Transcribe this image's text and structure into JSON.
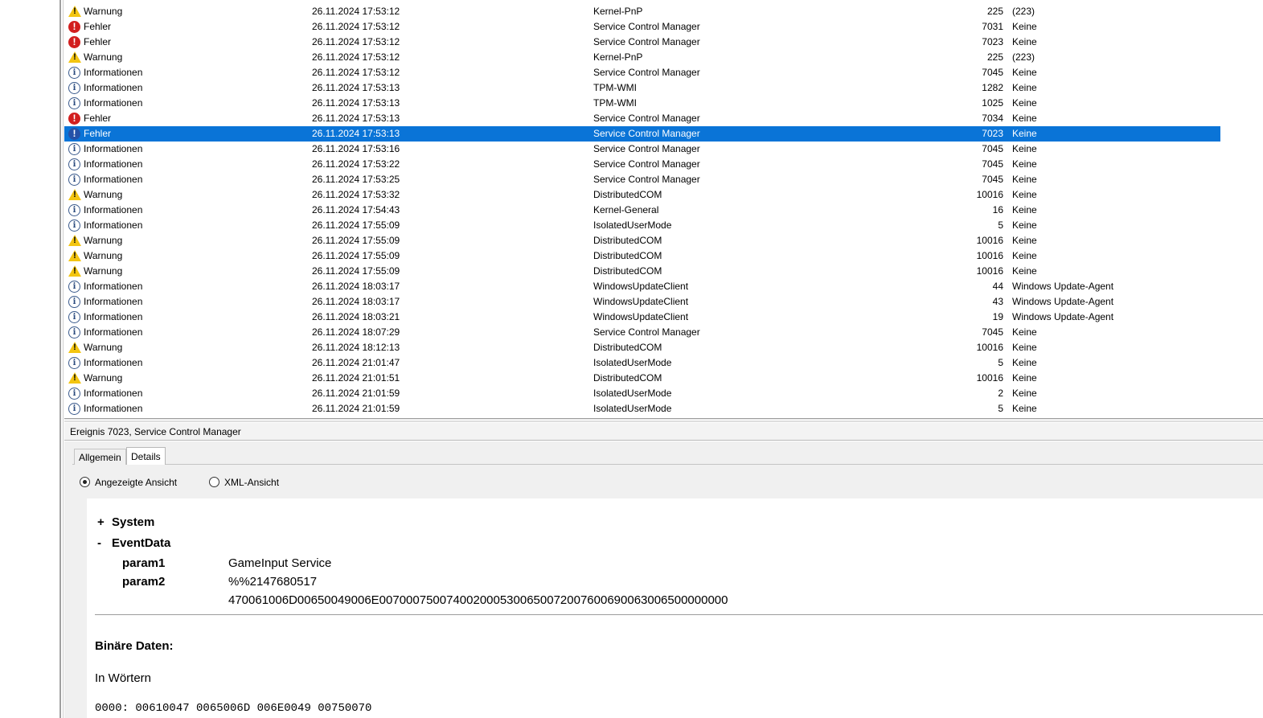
{
  "events": [
    {
      "level": "Warnung",
      "type": "warning",
      "date": "26.11.2024 17:53:12",
      "source": "Kernel-PnP",
      "id": "225",
      "task": "(223)"
    },
    {
      "level": "Fehler",
      "type": "error",
      "date": "26.11.2024 17:53:12",
      "source": "Service Control Manager",
      "id": "7031",
      "task": "Keine"
    },
    {
      "level": "Fehler",
      "type": "error",
      "date": "26.11.2024 17:53:12",
      "source": "Service Control Manager",
      "id": "7023",
      "task": "Keine"
    },
    {
      "level": "Warnung",
      "type": "warning",
      "date": "26.11.2024 17:53:12",
      "source": "Kernel-PnP",
      "id": "225",
      "task": "(223)"
    },
    {
      "level": "Informationen",
      "type": "info",
      "date": "26.11.2024 17:53:12",
      "source": "Service Control Manager",
      "id": "7045",
      "task": "Keine"
    },
    {
      "level": "Informationen",
      "type": "info",
      "date": "26.11.2024 17:53:13",
      "source": "TPM-WMI",
      "id": "1282",
      "task": "Keine"
    },
    {
      "level": "Informationen",
      "type": "info",
      "date": "26.11.2024 17:53:13",
      "source": "TPM-WMI",
      "id": "1025",
      "task": "Keine"
    },
    {
      "level": "Fehler",
      "type": "error",
      "date": "26.11.2024 17:53:13",
      "source": "Service Control Manager",
      "id": "7034",
      "task": "Keine"
    },
    {
      "level": "Fehler",
      "type": "error",
      "date": "26.11.2024 17:53:13",
      "source": "Service Control Manager",
      "id": "7023",
      "task": "Keine",
      "selected": true
    },
    {
      "level": "Informationen",
      "type": "info",
      "date": "26.11.2024 17:53:16",
      "source": "Service Control Manager",
      "id": "7045",
      "task": "Keine"
    },
    {
      "level": "Informationen",
      "type": "info",
      "date": "26.11.2024 17:53:22",
      "source": "Service Control Manager",
      "id": "7045",
      "task": "Keine"
    },
    {
      "level": "Informationen",
      "type": "info",
      "date": "26.11.2024 17:53:25",
      "source": "Service Control Manager",
      "id": "7045",
      "task": "Keine"
    },
    {
      "level": "Warnung",
      "type": "warning",
      "date": "26.11.2024 17:53:32",
      "source": "DistributedCOM",
      "id": "10016",
      "task": "Keine"
    },
    {
      "level": "Informationen",
      "type": "info",
      "date": "26.11.2024 17:54:43",
      "source": "Kernel-General",
      "id": "16",
      "task": "Keine"
    },
    {
      "level": "Informationen",
      "type": "info",
      "date": "26.11.2024 17:55:09",
      "source": "IsolatedUserMode",
      "id": "5",
      "task": "Keine"
    },
    {
      "level": "Warnung",
      "type": "warning",
      "date": "26.11.2024 17:55:09",
      "source": "DistributedCOM",
      "id": "10016",
      "task": "Keine"
    },
    {
      "level": "Warnung",
      "type": "warning",
      "date": "26.11.2024 17:55:09",
      "source": "DistributedCOM",
      "id": "10016",
      "task": "Keine"
    },
    {
      "level": "Warnung",
      "type": "warning",
      "date": "26.11.2024 17:55:09",
      "source": "DistributedCOM",
      "id": "10016",
      "task": "Keine"
    },
    {
      "level": "Informationen",
      "type": "info",
      "date": "26.11.2024 18:03:17",
      "source": "WindowsUpdateClient",
      "id": "44",
      "task": "Windows Update-Agent"
    },
    {
      "level": "Informationen",
      "type": "info",
      "date": "26.11.2024 18:03:17",
      "source": "WindowsUpdateClient",
      "id": "43",
      "task": "Windows Update-Agent"
    },
    {
      "level": "Informationen",
      "type": "info",
      "date": "26.11.2024 18:03:21",
      "source": "WindowsUpdateClient",
      "id": "19",
      "task": "Windows Update-Agent"
    },
    {
      "level": "Informationen",
      "type": "info",
      "date": "26.11.2024 18:07:29",
      "source": "Service Control Manager",
      "id": "7045",
      "task": "Keine"
    },
    {
      "level": "Warnung",
      "type": "warning",
      "date": "26.11.2024 18:12:13",
      "source": "DistributedCOM",
      "id": "10016",
      "task": "Keine"
    },
    {
      "level": "Informationen",
      "type": "info",
      "date": "26.11.2024 21:01:47",
      "source": "IsolatedUserMode",
      "id": "5",
      "task": "Keine"
    },
    {
      "level": "Warnung",
      "type": "warning",
      "date": "26.11.2024 21:01:51",
      "source": "DistributedCOM",
      "id": "10016",
      "task": "Keine"
    },
    {
      "level": "Informationen",
      "type": "info",
      "date": "26.11.2024 21:01:59",
      "source": "IsolatedUserMode",
      "id": "2",
      "task": "Keine"
    },
    {
      "level": "Informationen",
      "type": "info",
      "date": "26.11.2024 21:01:59",
      "source": "IsolatedUserMode",
      "id": "5",
      "task": "Keine"
    }
  ],
  "icons": {
    "info": "info-icon",
    "error": "error-icon",
    "warning": "warning-icon"
  },
  "colors": {
    "selection": "#0a74d7",
    "error": "#d21f1f",
    "warning": "#f3c511",
    "info": "#3a5a8c"
  },
  "detail": {
    "header": "Ereignis 7023, Service Control Manager",
    "tabs": {
      "general": "Allgemein",
      "details": "Details"
    },
    "radios": {
      "friendly": "Angezeigte Ansicht",
      "xml": "XML-Ansicht",
      "selected": "friendly"
    },
    "tree": {
      "system_toggle": "+",
      "system_label": "System",
      "eventdata_toggle": "-",
      "eventdata_label": "EventData",
      "param1_name": "param1",
      "param1_value": "GameInput Service",
      "param2_name": "param2",
      "param2_value": "%%2147680517",
      "param3_value": "470061006D00650049006E0070007500740020005300650072007600690063006500000000"
    },
    "binary_title": "Binäre Daten:",
    "words_label": "In Wörtern",
    "hex_line": "0000: 00610047 0065006D 006E0049 00750070"
  }
}
